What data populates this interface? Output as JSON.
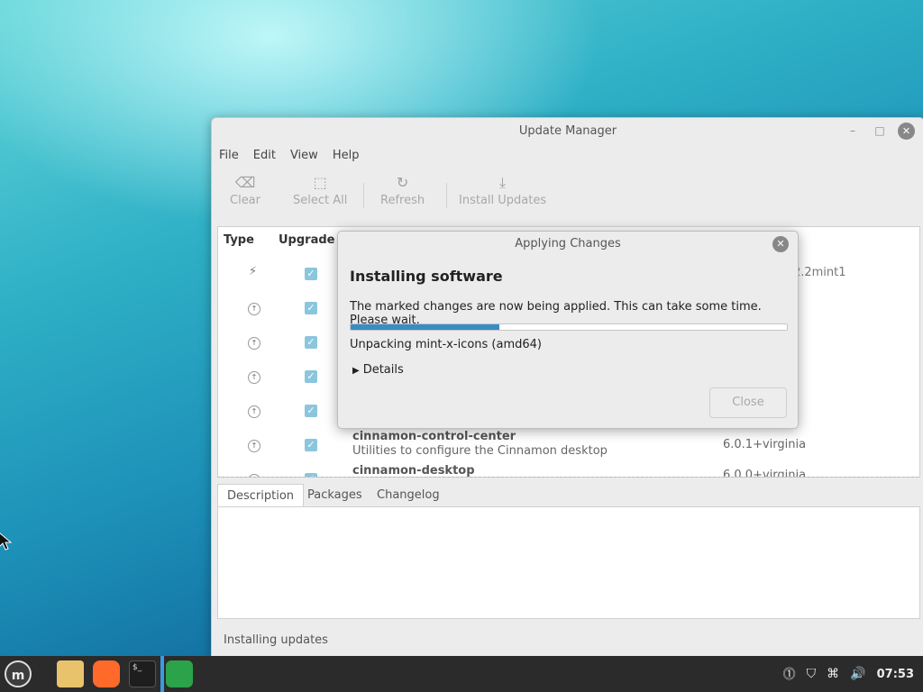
{
  "window": {
    "title": "Update Manager",
    "menu": [
      "File",
      "Edit",
      "View",
      "Help"
    ],
    "toolbar": {
      "clear": "Clear",
      "select_all": "Select All",
      "refresh": "Refresh",
      "install_updates": "Install Updates"
    },
    "columns": {
      "type": "Type",
      "upgrade": "Upgrade"
    },
    "rows": [
      {
        "version_partial": "a2.2mint1"
      },
      {
        "name": "cinnamon-control-center",
        "description": "Utilities to configure the Cinnamon desktop",
        "version": "6.0.1+virginia"
      },
      {
        "name": "cinnamon-desktop",
        "version": "6.0.0+virginia"
      }
    ],
    "tabs": [
      "Description",
      "Packages",
      "Changelog"
    ],
    "status": "Installing updates"
  },
  "dialog": {
    "title": "Applying Changes",
    "heading": "Installing software",
    "message": "The marked changes are now being applied. This can take some time. Please wait.",
    "progress": 0.34,
    "current_action": "Unpacking mint-x-icons (amd64)",
    "details_label": "Details",
    "close_label": "Close"
  },
  "taskbar": {
    "clock": "07:53"
  }
}
